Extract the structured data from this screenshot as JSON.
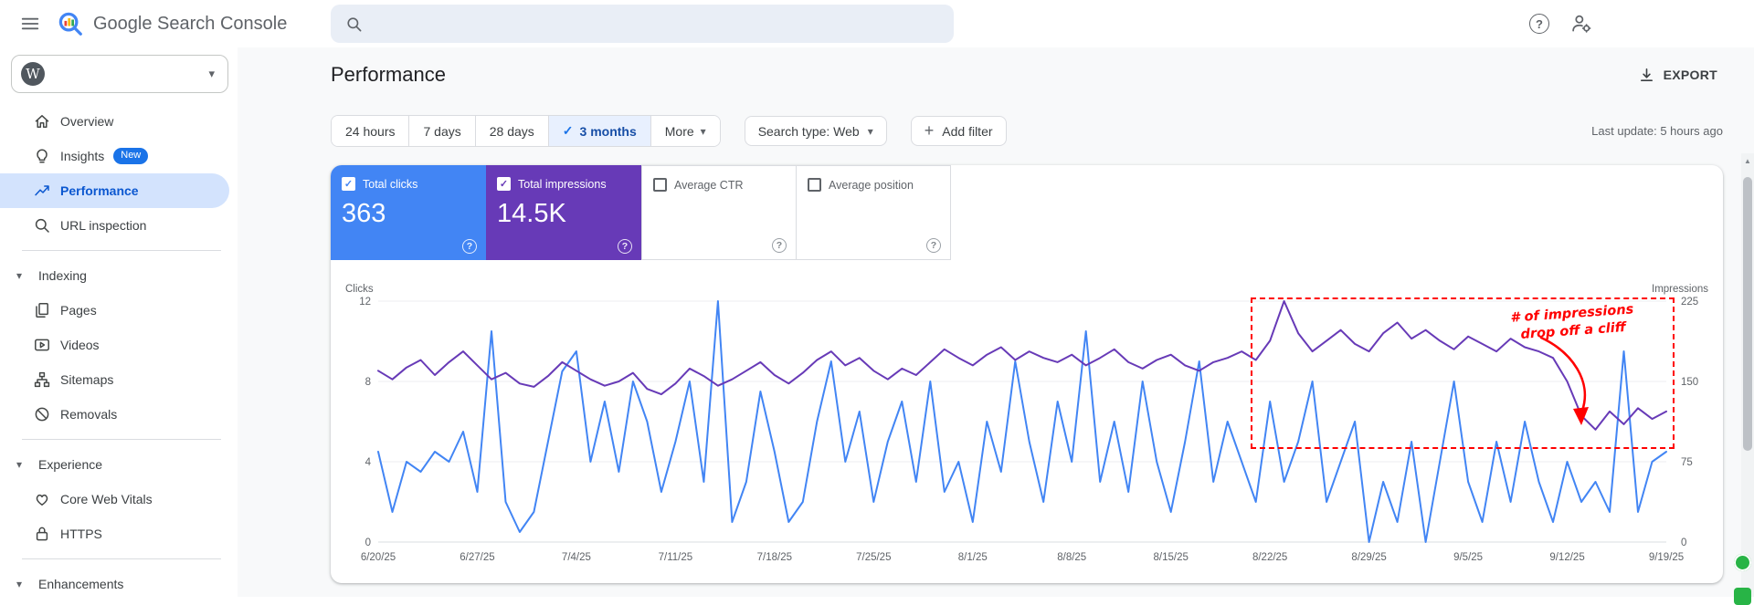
{
  "icons": {
    "help_glyph": "?",
    "caret_glyph": "▾",
    "check_glyph": "✓",
    "plus_glyph": "+",
    "wordpress_glyph": "W",
    "scroll_up_glyph": "▲"
  },
  "header": {
    "app_name": "Google Search Console",
    "search": {
      "value": "",
      "placeholder": ""
    }
  },
  "sidebar": {
    "nav": [
      {
        "label": "Overview",
        "active": false
      },
      {
        "label": "Insights",
        "badge": "New",
        "active": false
      },
      {
        "label": "Performance",
        "active": true
      },
      {
        "label": "URL inspection",
        "active": false
      }
    ],
    "sections": [
      {
        "label": "Indexing",
        "items": [
          {
            "label": "Pages"
          },
          {
            "label": "Videos"
          },
          {
            "label": "Sitemaps"
          },
          {
            "label": "Removals"
          }
        ]
      },
      {
        "label": "Experience",
        "items": [
          {
            "label": "Core Web Vitals"
          },
          {
            "label": "HTTPS"
          }
        ]
      },
      {
        "label": "Enhancements",
        "items": []
      }
    ]
  },
  "toolbar": {
    "title": "Performance",
    "export_label": "EXPORT",
    "last_update": "Last update: 5 hours ago",
    "date_ranges": [
      "24 hours",
      "7 days",
      "28 days",
      "3 months"
    ],
    "selected_range": "3 months",
    "more_label": "More",
    "search_type_label": "Search type: Web",
    "add_filter_label": "Add filter"
  },
  "metrics": [
    {
      "label": "Total clicks",
      "value": "363",
      "checked": true,
      "color": "#4285f4"
    },
    {
      "label": "Total impressions",
      "value": "14.5K",
      "checked": true,
      "color": "#673ab7"
    },
    {
      "label": "Average CTR",
      "value": "",
      "checked": false,
      "color": "#ffffff"
    },
    {
      "label": "Average position",
      "value": "",
      "checked": false,
      "color": "#ffffff"
    }
  ],
  "chart_data": {
    "type": "line",
    "x_tick_labels": [
      "6/20/25",
      "6/27/25",
      "7/4/25",
      "7/11/25",
      "7/18/25",
      "7/25/25",
      "8/1/25",
      "8/8/25",
      "8/15/25",
      "8/22/25",
      "8/29/25",
      "9/5/25",
      "9/12/25",
      "9/19/25"
    ],
    "left_axis": {
      "label": "Clicks",
      "ticks": [
        0,
        4,
        8,
        12
      ],
      "range": [
        0,
        12
      ]
    },
    "right_axis": {
      "label": "Impressions",
      "ticks": [
        0,
        75,
        150,
        225
      ],
      "range": [
        0,
        225
      ]
    },
    "grid": true,
    "legend_position": "none",
    "series": [
      {
        "name": "Total clicks",
        "axis": "left",
        "color": "#4285f4",
        "values": [
          4.5,
          1.5,
          4,
          3.5,
          4.5,
          4,
          5.5,
          2.5,
          10.5,
          2,
          0.5,
          1.5,
          5,
          8.5,
          9.5,
          4,
          7,
          3.5,
          8,
          6,
          2.5,
          5,
          8,
          3,
          12,
          1,
          3,
          7.5,
          4.5,
          1,
          2,
          6,
          9,
          4,
          6.5,
          2,
          5,
          7,
          3,
          8,
          2.5,
          4,
          1,
          6,
          3.5,
          9,
          5,
          2,
          7,
          4,
          10.5,
          3,
          6,
          2.5,
          8,
          4,
          1.5,
          5,
          9,
          3,
          6,
          4,
          2,
          7,
          3,
          5,
          8,
          2,
          4,
          6,
          0,
          3,
          1,
          5,
          0,
          4,
          8,
          3,
          1,
          5,
          2,
          6,
          3,
          1,
          4,
          2,
          3,
          1.5,
          9.5,
          1.5,
          4,
          4.5
        ]
      },
      {
        "name": "Total impressions",
        "axis": "right",
        "color": "#673ab7",
        "values": [
          160,
          152,
          163,
          170,
          156,
          168,
          178,
          165,
          152,
          158,
          148,
          145,
          155,
          168,
          160,
          152,
          146,
          150,
          158,
          143,
          138,
          148,
          162,
          155,
          146,
          152,
          160,
          168,
          156,
          148,
          158,
          170,
          178,
          165,
          172,
          160,
          152,
          162,
          156,
          168,
          180,
          172,
          165,
          175,
          182,
          170,
          178,
          172,
          168,
          175,
          165,
          172,
          180,
          168,
          162,
          170,
          175,
          165,
          160,
          168,
          172,
          178,
          170,
          188,
          225,
          195,
          178,
          188,
          198,
          185,
          178,
          195,
          205,
          190,
          198,
          188,
          180,
          192,
          185,
          178,
          190,
          182,
          178,
          172,
          150,
          118,
          105,
          122,
          110,
          125,
          115,
          122
        ]
      }
    ],
    "annotation": {
      "line1": "# of impressions",
      "line2": "drop off a cliff",
      "color": "#ff0000",
      "box": {
        "from_label": "8/21/25",
        "to_label": "9/19/25"
      },
      "arrow_points_to": "9/14/25"
    }
  }
}
